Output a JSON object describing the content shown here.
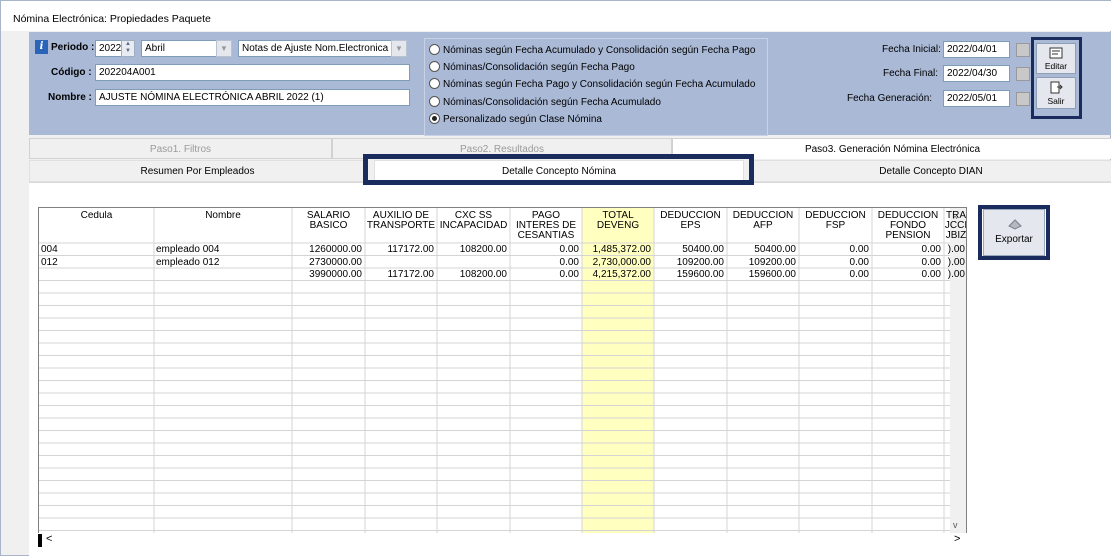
{
  "window": {
    "title": "Nómina Electrónica: Propiedades Paquete"
  },
  "header": {
    "periodo_label": "Periodo :",
    "year": "2022",
    "month": "Abril",
    "tipo": "Notas de Ajuste Nom.Electronica",
    "codigo_label": "Código :",
    "codigo": "202204A001",
    "nombre_label": "Nombre :",
    "nombre": "AJUSTE NÓMINA ELECTRÓNICA ABRIL 2022 (1)",
    "options": [
      "Nóminas según Fecha Acumulado y Consolidación según Fecha Pago",
      "Nóminas/Consolidación según Fecha Pago",
      "Nóminas según Fecha Pago y Consolidación según Fecha Acumulado",
      "Nóminas/Consolidación según Fecha Acumulado",
      "Personalizado según Clase Nómina"
    ],
    "selected_option": 4,
    "fecha_inicial_label": "Fecha Inicial:",
    "fecha_inicial": "2022/04/01",
    "fecha_final_label": "Fecha Final:",
    "fecha_final": "2022/04/30",
    "fecha_generacion_label": "Fecha Generación:",
    "fecha_generacion": "2022/05/01",
    "editar_label": "Editar",
    "salir_label": "Salir"
  },
  "tabs": {
    "main": [
      "Paso1. Filtros",
      "Paso2. Resultados",
      "Paso3. Generación Nómina Electrónica"
    ],
    "active_main": 2,
    "sub": [
      "Resumen Por Empleados",
      "Detalle Concepto Nómina",
      "Detalle Concepto DIAN"
    ],
    "active_sub": 1
  },
  "table": {
    "columns": [
      "Cedula",
      "Nombre",
      "SALARIO BASICO",
      "AUXILIO DE TRANSPORTE",
      "CXC SS INCAPACIDAD",
      "PAGO INTERES DE CESANTIAS",
      "TOTAL DEVENG",
      "DEDUCCION EPS",
      "DEDUCCION AFP",
      "DEDUCCION FSP",
      "DEDUCCION FONDO PENSION",
      "TRA JCCI JBIZ"
    ],
    "rows": [
      [
        "004",
        "empleado 004",
        "1260000.00",
        "117172.00",
        "108200.00",
        "0.00",
        "1,485,372.00",
        "50400.00",
        "50400.00",
        "0.00",
        "0.00",
        ").00"
      ],
      [
        "012",
        "empleado 012",
        "2730000.00",
        "",
        "",
        "0.00",
        "2,730,000.00",
        "109200.00",
        "109200.00",
        "0.00",
        "0.00",
        ").00"
      ],
      [
        "",
        "",
        "3990000.00",
        "117172.00",
        "108200.00",
        "0.00",
        "4,215,372.00",
        "159600.00",
        "159600.00",
        "0.00",
        "0.00",
        ").00"
      ]
    ],
    "highlight_color": "#ffffc0"
  },
  "actions": {
    "exportar_label": "Exportar"
  }
}
